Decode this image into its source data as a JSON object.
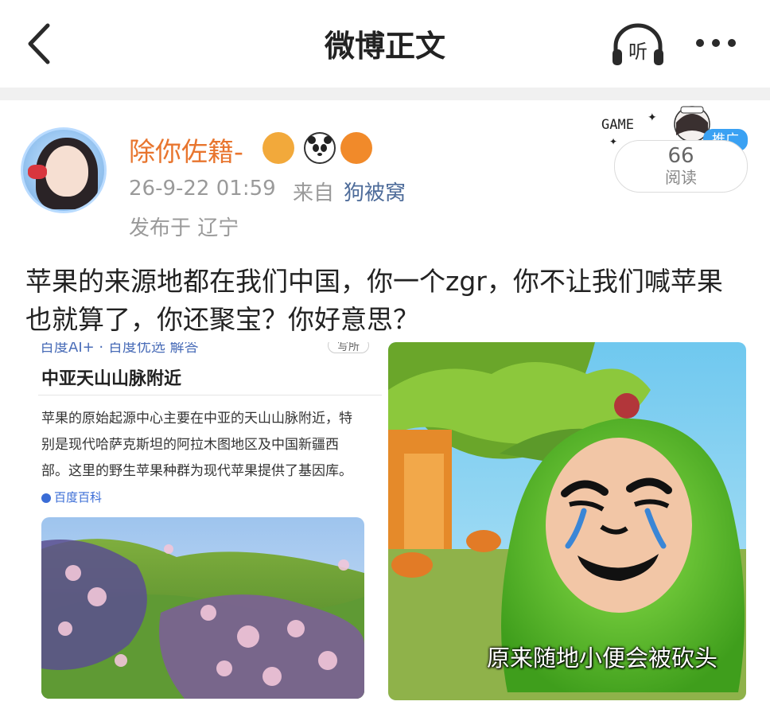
{
  "header": {
    "title": "微博正文",
    "listen_label": "听"
  },
  "post": {
    "author": "除你佐籍-",
    "time": "26-9-22 01:59",
    "from_prefix": "来自",
    "source": "狗被窝",
    "location": "发布于 辽宁",
    "promo_tag": "推广",
    "promo_art_text": "GAME",
    "read_count": "66",
    "read_label": "阅读",
    "content": "苹果的来源地都在我们中国，你一个zgr，你不让我们喊苹果也就算了，你还聚宝？你好意思？"
  },
  "images": {
    "left": {
      "header_cut": "百度AI+ · 百度优选 解答",
      "header_cut_right": "写所",
      "subtitle": "中亚天山山脉附近",
      "body": "苹果的原始起源中心主要在中亚的天山山脉附近，特别是现代哈萨克斯坦的阿拉木图地区及中国新疆西部。这里的野生苹果种群为现代苹果提供了基因库。",
      "source_tag": "百度百科"
    },
    "right": {
      "caption": "原来随地小便会被砍头"
    }
  },
  "icons": {
    "back": "chevron-left-icon",
    "listen": "headphones-listen-icon",
    "more": "more-dots-icon"
  },
  "colors": {
    "username": "#e8752e",
    "link": "#4e6c9a",
    "promo": "#3aa1f3",
    "meta": "#9a9a9a"
  }
}
